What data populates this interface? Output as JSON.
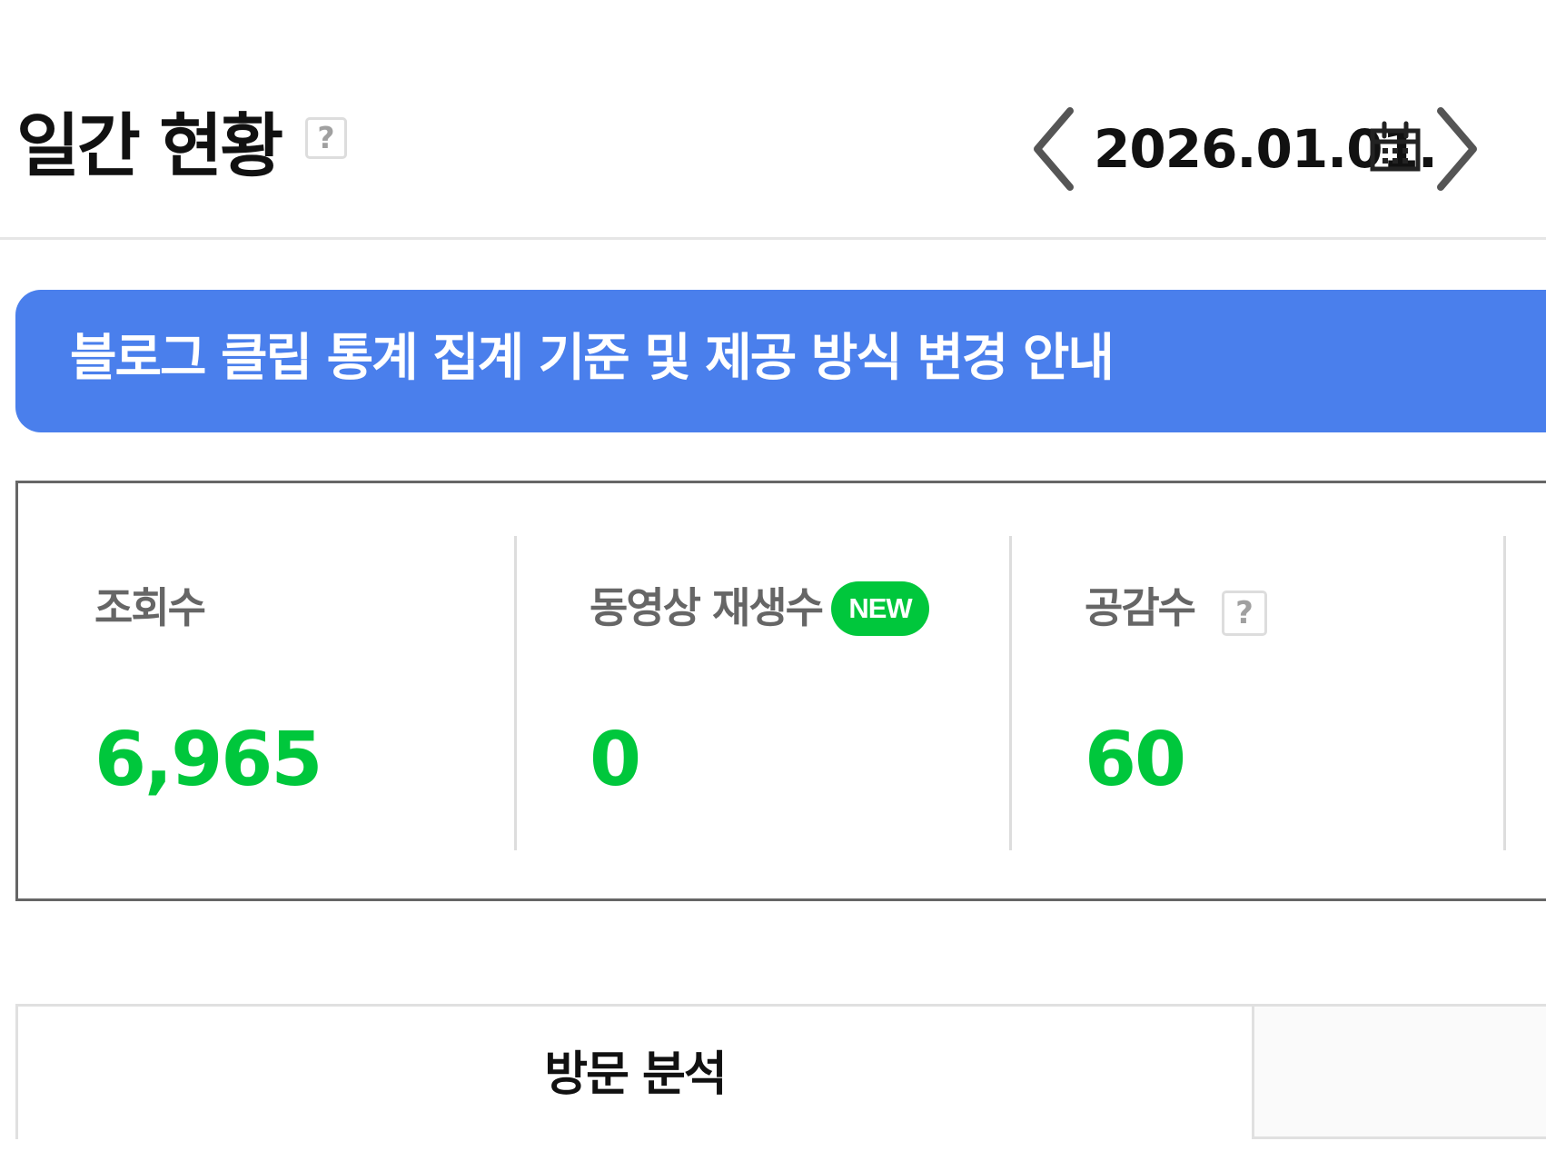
{
  "header": {
    "title": "일간 현황",
    "help_icon": "question-mark-icon",
    "date": "2026.01.01.",
    "prev_icon": "chevron-left-icon",
    "next_icon": "chevron-right-icon",
    "calendar_icon": "calendar-icon"
  },
  "notice": {
    "text": "블로그 클립 통계 집계 기준 및 제공 방식 변경 안내"
  },
  "stats": [
    {
      "label": "조회수",
      "value": "6,965"
    },
    {
      "label": "동영상 재생수",
      "value": "0",
      "badge": "NEW"
    },
    {
      "label": "공감수",
      "value": "60",
      "help_icon": "question-mark-icon"
    }
  ],
  "tabs": [
    {
      "label": "방문 분석",
      "active": true
    }
  ],
  "colors": {
    "notice_blue": "#4a7fec",
    "stat_green": "#00c73c",
    "label_gray": "#666666",
    "border_light": "#e6e6e6"
  }
}
